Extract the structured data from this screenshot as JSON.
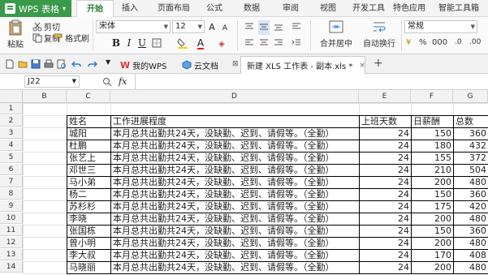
{
  "app": {
    "title": "WPS 表格"
  },
  "menu": [
    "开始",
    "插入",
    "页面布局",
    "公式",
    "数据",
    "审阅",
    "视图",
    "开发工具",
    "特色应用",
    "智能工具箱"
  ],
  "ribbon": {
    "paste": "粘贴",
    "cut": "剪切",
    "copy": "复制",
    "format_painter": "格式刷",
    "font_name": "宋体",
    "font_size": "12",
    "bold": "B",
    "italic": "I",
    "underline": "U",
    "merge_center": "合并居中",
    "wrap_text": "自动换行",
    "number_format": "常规"
  },
  "doc_tabs": [
    {
      "label": "我的WPS"
    },
    {
      "label": "云文档"
    },
    {
      "label": "新建 XLS 工作表 - 副本.xls *"
    }
  ],
  "formula_bar": {
    "cell_ref": "J22",
    "fx": "fx"
  },
  "sheet": {
    "columns": [
      "B",
      "C",
      "D",
      "E",
      "F",
      "G"
    ],
    "rows": [
      "1",
      "2",
      "3",
      "4",
      "5",
      "6",
      "7",
      "8",
      "9",
      "10",
      "11",
      "12",
      "13",
      "14"
    ],
    "headers": {
      "name": "姓名",
      "progress": "工作进展程度",
      "days": "上班天数",
      "salary": "日薪酬",
      "total": "总数"
    },
    "data": [
      {
        "name": "城阳",
        "progress": "本月总共出勤共24天，没缺勤、迟到、请假等。（全勤）",
        "days": "24",
        "salary": "150",
        "total": "360"
      },
      {
        "name": "杜鹏",
        "progress": "本月总共出勤共24天，没缺勤、迟到、请假等。（全勤）",
        "days": "24",
        "salary": "180",
        "total": "432"
      },
      {
        "name": "张艺上",
        "progress": "本月总共出勤共24天，没缺勤、迟到、请假等。（全勤）",
        "days": "24",
        "salary": "155",
        "total": "372"
      },
      {
        "name": "邓世三",
        "progress": "本月总共出勤共24天，没缺勤、迟到、请假等。（全勤）",
        "days": "24",
        "salary": "210",
        "total": "504"
      },
      {
        "name": "马小弟",
        "progress": "本月总共出勤共24天，没缺勤、迟到、请假等。（全勤）",
        "days": "24",
        "salary": "200",
        "total": "480"
      },
      {
        "name": "杨二",
        "progress": "本月总共出勤共24天，没缺勤、迟到、请假等。（全勤）",
        "days": "24",
        "salary": "150",
        "total": "360"
      },
      {
        "name": "苏杉杉",
        "progress": "本月总共出勤共24天，没缺勤、迟到、请假等。（全勤）",
        "days": "24",
        "salary": "175",
        "total": "420"
      },
      {
        "name": "李晓",
        "progress": "本月总共出勤共24天，没缺勤、迟到、请假等。（全勤）",
        "days": "24",
        "salary": "200",
        "total": "480"
      },
      {
        "name": "张国栋",
        "progress": "本月总共出勤共24天，没缺勤、迟到、请假等。（全勤）",
        "days": "24",
        "salary": "150",
        "total": "360"
      },
      {
        "name": "曾小明",
        "progress": "本月总共出勤共24天，没缺勤、迟到、请假等。（全勤）",
        "days": "24",
        "salary": "200",
        "total": "480"
      },
      {
        "name": "李大叔",
        "progress": "本月总共出勤共24天，没缺勤、迟到、请假等。（全勤）",
        "days": "24",
        "salary": "170",
        "total": "408"
      },
      {
        "name": "马晓丽",
        "progress": "本月总共出勤共24天，没缺勤、迟到、请假等。（全勤）",
        "days": "24",
        "salary": "200",
        "total": "480"
      }
    ]
  }
}
